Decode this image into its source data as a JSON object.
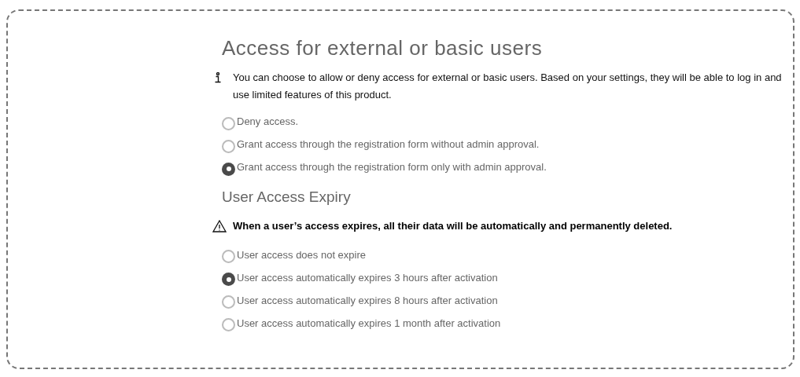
{
  "access": {
    "title": "Access for external or basic users",
    "info": "You can choose to allow or deny access for external or basic users. Based on your settings, they will be able to log in and use limited features of this product.",
    "options": [
      {
        "label": "Deny access.",
        "selected": false
      },
      {
        "label": "Grant access through the registration form without admin approval.",
        "selected": false
      },
      {
        "label": "Grant access through the registration form only with admin approval.",
        "selected": true
      }
    ]
  },
  "expiry": {
    "title": "User Access Expiry",
    "warning": "When a user’s access expires, all their data will be automatically and permanently deleted.",
    "options": [
      {
        "label": "User access does not expire",
        "selected": false
      },
      {
        "label": "User access automatically expires 3 hours after activation",
        "selected": true
      },
      {
        "label": "User access automatically expires 8 hours after activation",
        "selected": false
      },
      {
        "label": "User access automatically expires 1 month after activation",
        "selected": false
      }
    ]
  }
}
